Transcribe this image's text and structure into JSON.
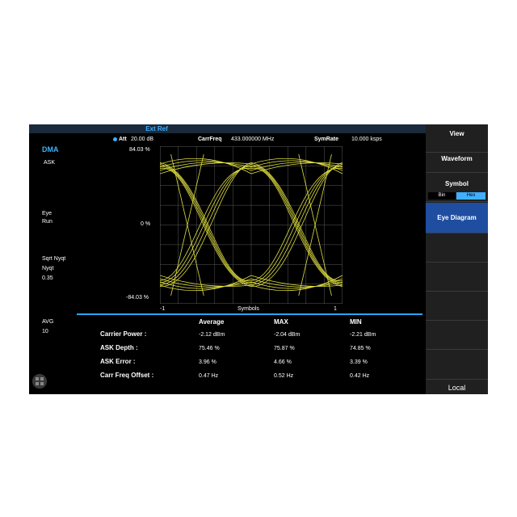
{
  "tabbar": {
    "ext_ref": "Ext Ref"
  },
  "header": {
    "att_label": "Att",
    "att_value": "20.00 dB",
    "carrfreq_label": "CarrFreq",
    "carrfreq_value": "433.000000 MHz",
    "symrate_label": "SymRate",
    "symrate_value": "10.000 ksps"
  },
  "left_panel": {
    "mode": "DMA",
    "modulation": "ASK",
    "eye_label": "Eye",
    "eye_state": "Run",
    "filter_label": "Sqrt Nyqt",
    "filter_value": "Nyqt",
    "alpha": "0.35",
    "avg_label": "AVG",
    "avg_value": "10"
  },
  "plot": {
    "y_top": "84.03 %",
    "y_mid": "0 %",
    "y_bottom": "-84.03 %",
    "x_left": "-1",
    "x_mid": "Symbols",
    "x_right": "1",
    "trace_color": "#e0e040",
    "grid_color": "#5a5a5a"
  },
  "results": {
    "headers": [
      "Average",
      "MAX",
      "MIN"
    ],
    "rows": [
      {
        "label": "Carrier Power :",
        "avg": "-2.12 dBm",
        "max": "-2.04 dBm",
        "min": "-2.21 dBm"
      },
      {
        "label": "ASK Depth :",
        "avg": "75.46 %",
        "max": "75.87 %",
        "min": "74.85 %"
      },
      {
        "label": "ASK Error :",
        "avg": "3.96 %",
        "max": "4.66 %",
        "min": "3.39 %"
      },
      {
        "label": "Carr Freq Offset :",
        "avg": "0.47 Hz",
        "max": "0.52 Hz",
        "min": "0.42 Hz"
      }
    ]
  },
  "menu": {
    "view": "View",
    "waveform": "Waveform",
    "symbol": "Symbol",
    "bin": "Bin",
    "hex": "Hex",
    "eye_diagram": "Eye Diagram",
    "local": "Local"
  },
  "colors": {
    "accent": "#3fb0ff",
    "active_menu": "#1f4ea0",
    "trace": "#e0e040"
  }
}
